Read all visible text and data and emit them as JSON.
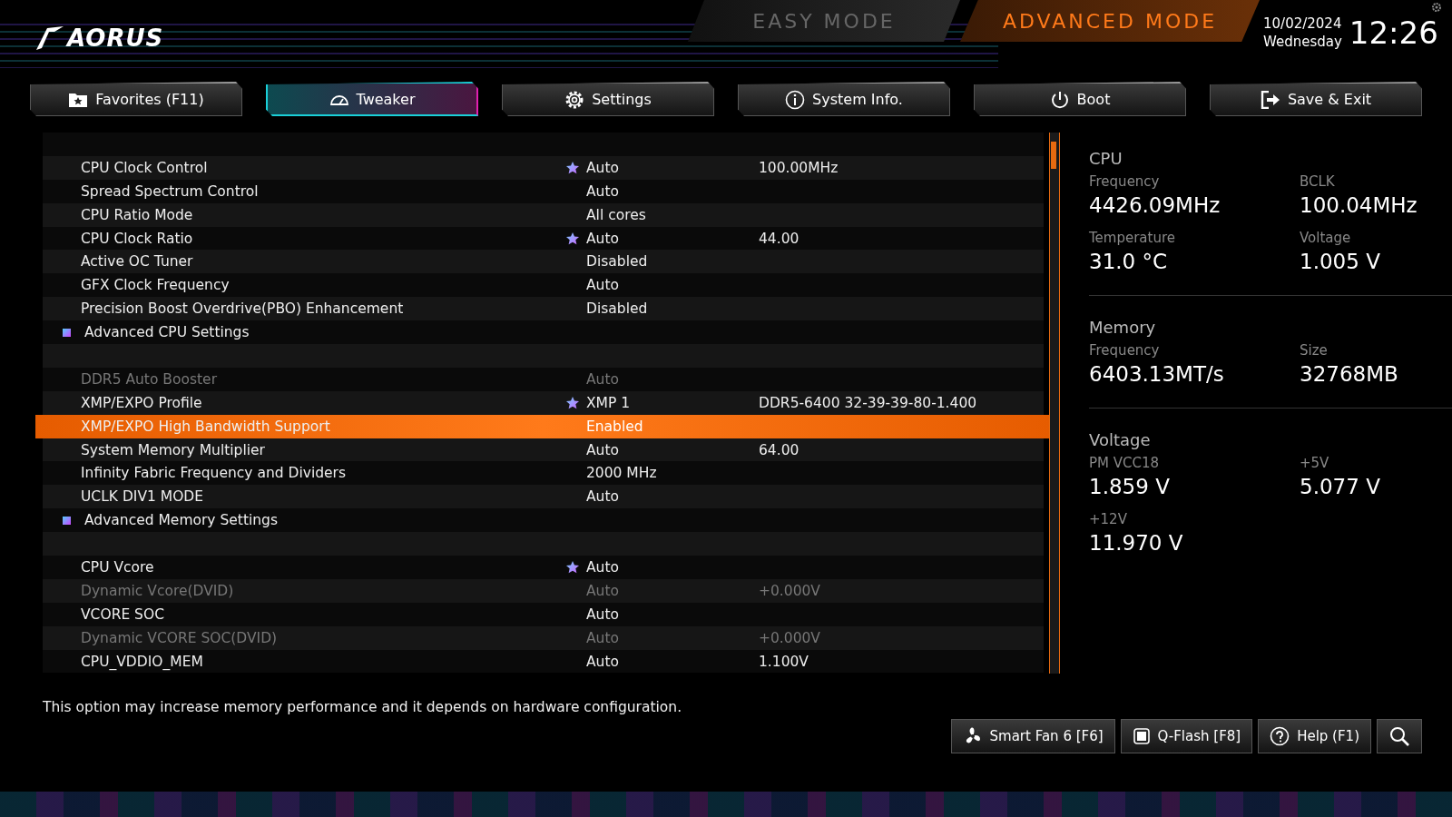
{
  "logo": "AORUS",
  "modes": [
    {
      "label": "EASY MODE",
      "selected": false
    },
    {
      "label": "ADVANCED MODE",
      "selected": true
    }
  ],
  "clock": {
    "date": "10/02/2024",
    "weekday": "Wednesday",
    "time": "12:26"
  },
  "tabs": [
    {
      "label": "Favorites (F11)",
      "selected": false
    },
    {
      "label": "Tweaker",
      "selected": true
    },
    {
      "label": "Settings",
      "selected": false
    },
    {
      "label": "System Info.",
      "selected": false
    },
    {
      "label": "Boot",
      "selected": false
    },
    {
      "label": "Save & Exit",
      "selected": false
    }
  ],
  "rows": [
    {
      "kind": "blank"
    },
    {
      "kind": "setting",
      "label": "CPU Clock Control",
      "starred": true,
      "value": "Auto",
      "detail": "100.00MHz",
      "disabled": false,
      "selected": false
    },
    {
      "kind": "setting",
      "label": "Spread Spectrum Control",
      "starred": false,
      "value": "Auto",
      "disabled": false,
      "selected": false
    },
    {
      "kind": "setting",
      "label": "CPU Ratio Mode",
      "starred": false,
      "value": "All cores",
      "disabled": false,
      "selected": false
    },
    {
      "kind": "setting",
      "label": "CPU Clock Ratio",
      "starred": true,
      "value": "Auto",
      "detail": "44.00",
      "disabled": false,
      "selected": false
    },
    {
      "kind": "setting",
      "label": "Active OC Tuner",
      "starred": false,
      "value": "Disabled",
      "disabled": false,
      "selected": false
    },
    {
      "kind": "setting",
      "label": "GFX Clock Frequency",
      "starred": false,
      "value": "Auto",
      "disabled": false,
      "selected": false
    },
    {
      "kind": "setting",
      "label": "Precision Boost Overdrive(PBO) Enhancement",
      "starred": false,
      "value": "Disabled",
      "disabled": false,
      "selected": false
    },
    {
      "kind": "submenu",
      "label": "Advanced CPU Settings"
    },
    {
      "kind": "blank"
    },
    {
      "kind": "setting",
      "label": "DDR5 Auto Booster",
      "starred": false,
      "value": "Auto",
      "disabled": true,
      "selected": false
    },
    {
      "kind": "setting",
      "label": "XMP/EXPO Profile",
      "starred": true,
      "value": "XMP 1",
      "detail": "DDR5-6400 32-39-39-80-1.400",
      "disabled": false,
      "selected": false
    },
    {
      "kind": "setting",
      "label": "XMP/EXPO High Bandwidth Support",
      "starred": false,
      "value": "Enabled",
      "disabled": false,
      "selected": true
    },
    {
      "kind": "setting",
      "label": "System Memory Multiplier",
      "starred": false,
      "value": "Auto",
      "detail": "64.00",
      "disabled": false,
      "selected": false
    },
    {
      "kind": "setting",
      "label": "Infinity Fabric Frequency and Dividers",
      "starred": false,
      "value": "2000 MHz",
      "disabled": false,
      "selected": false
    },
    {
      "kind": "setting",
      "label": "UCLK DIV1 MODE",
      "starred": false,
      "value": "Auto",
      "disabled": false,
      "selected": false
    },
    {
      "kind": "submenu",
      "label": "Advanced Memory Settings"
    },
    {
      "kind": "blank"
    },
    {
      "kind": "setting",
      "label": "CPU Vcore",
      "starred": true,
      "value": "Auto",
      "disabled": false,
      "selected": false
    },
    {
      "kind": "setting",
      "label": "Dynamic Vcore(DVID)",
      "starred": false,
      "value": "Auto",
      "detail": "+0.000V",
      "disabled": true,
      "selected": false
    },
    {
      "kind": "setting",
      "label": "VCORE SOC",
      "starred": false,
      "value": "Auto",
      "disabled": false,
      "selected": false
    },
    {
      "kind": "setting",
      "label": "Dynamic VCORE SOC(DVID)",
      "starred": false,
      "value": "Auto",
      "detail": "+0.000V",
      "disabled": true,
      "selected": false
    },
    {
      "kind": "setting",
      "label": "CPU_VDDIO_MEM",
      "starred": false,
      "value": "Auto",
      "detail": "1.100V",
      "disabled": false,
      "selected": false
    }
  ],
  "monitor": [
    {
      "title": "CPU",
      "readings": [
        {
          "label": "Frequency",
          "value": "4426.09MHz"
        },
        {
          "label": "BCLK",
          "value": "100.04MHz"
        },
        {
          "label": "Temperature",
          "value": "31.0 °C"
        },
        {
          "label": "Voltage",
          "value": "1.005 V"
        }
      ]
    },
    {
      "title": "Memory",
      "readings": [
        {
          "label": "Frequency",
          "value": "6403.13MT/s"
        },
        {
          "label": "Size",
          "value": "32768MB"
        }
      ]
    },
    {
      "title": "Voltage",
      "readings": [
        {
          "label": "PM VCC18",
          "value": "1.859 V"
        },
        {
          "label": "+5V",
          "value": "5.077 V"
        },
        {
          "label": "+12V",
          "value": "11.970 V"
        }
      ]
    }
  ],
  "description": "This option may increase memory performance and it depends on hardware configuration.",
  "bottom_buttons": [
    {
      "label": "Smart Fan 6 [F6]"
    },
    {
      "label": "Q-Flash [F8]"
    },
    {
      "label": "Help (F1)"
    },
    {
      "kind": "search"
    }
  ]
}
